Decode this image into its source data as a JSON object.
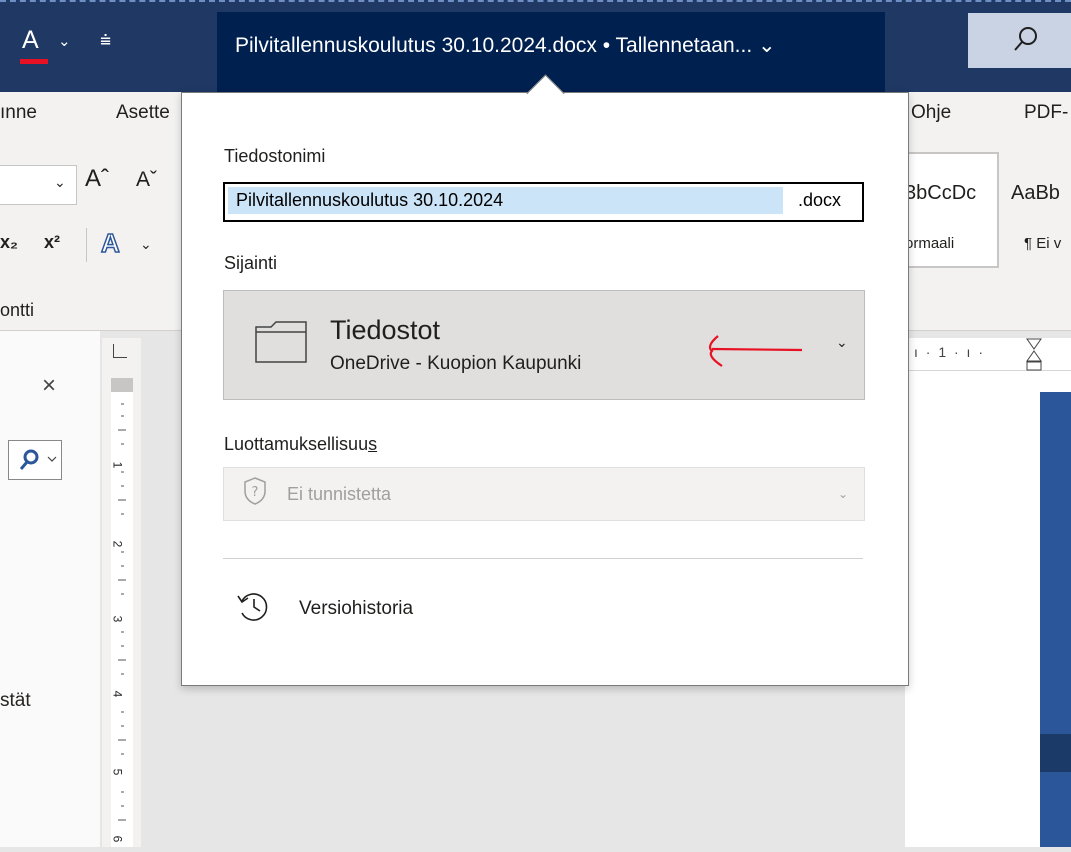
{
  "titlebar": {
    "font_color_glyph": "A",
    "qa_dropdown": "⌄",
    "qa_more": "⩧",
    "document_title": "Pilvitallennuskoulutus 30.10.2024.docx • Tallennetaan... ⌄"
  },
  "ribbon": {
    "tabs": {
      "left_partial": "ınne",
      "asetteltu_partial": "Asette",
      "help": "Ohje",
      "pdf_partial": "PDF-"
    },
    "font_grow": "Aˆ",
    "font_shrink": "Aˇ",
    "subscript": "x₂",
    "superscript": "x²",
    "text_effects": "A",
    "style_sample_1": "3bCcDc",
    "style_sample_2": "AaBb",
    "style_name_1": "ormaali",
    "style_name_2": "¶ Ei v",
    "group_font": "ontti"
  },
  "nav": {
    "close": "×",
    "partial_text": "stät"
  },
  "ruler": {
    "marks": [
      "1",
      "2",
      "3",
      "4",
      "5",
      "6"
    ],
    "h_marks": "ı · 1 · ı ·"
  },
  "flyout": {
    "filename_label": "Tiedostonimi",
    "filename_value": "Pilvitallennuskoulutus 30.10.2024",
    "filename_ext": ".docx",
    "location_label": "Sijainti",
    "location_name": "Tiedostot",
    "location_sub": "OneDrive - Kuopion Kaupunki",
    "location_chevron": "⌄",
    "sensitivity_label": "Luottamuksellisuu",
    "sensitivity_label_accel": "s",
    "sensitivity_value": "Ei tunnistetta",
    "sensitivity_chevron": "⌄",
    "version_history": "Versiohistoria"
  },
  "colors": {
    "title_bar": "#1f3864",
    "title_highlight": "#002050",
    "annotation_arrow": "#e81123"
  }
}
